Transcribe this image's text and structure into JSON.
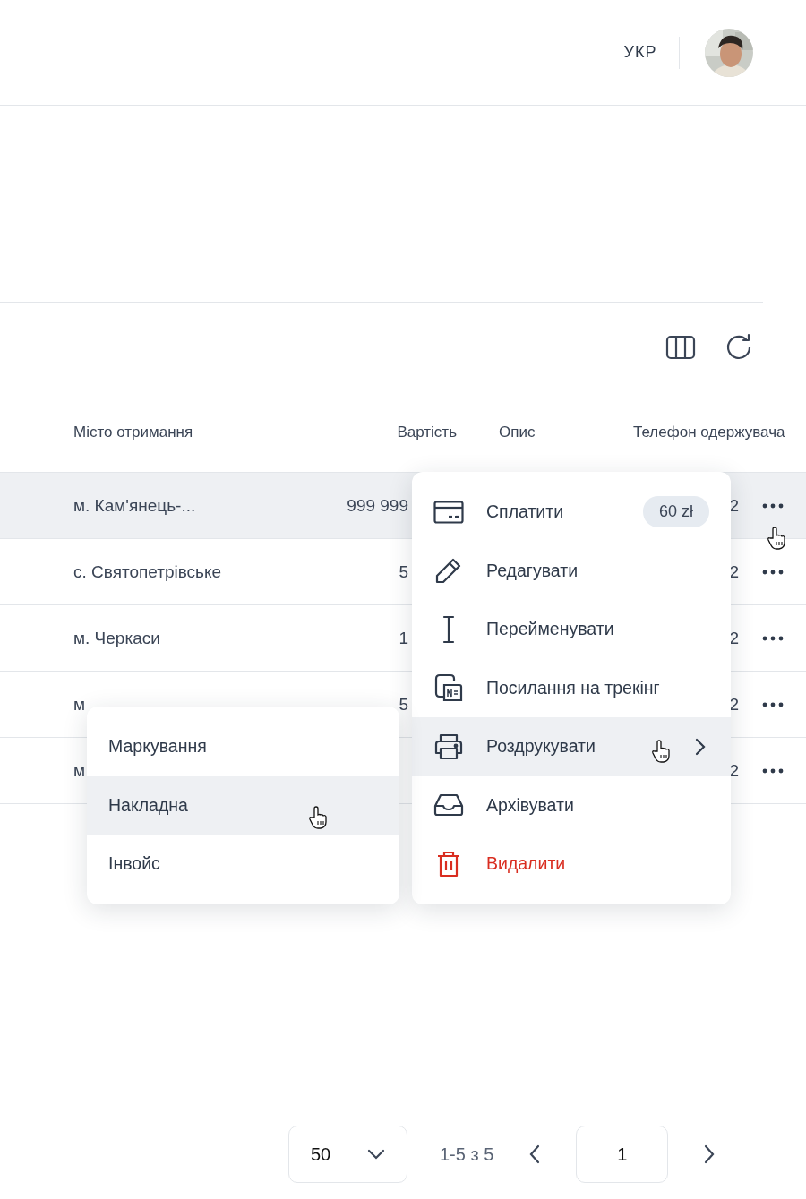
{
  "header": {
    "language": "УКР"
  },
  "table": {
    "columns": [
      "Місто отримання",
      "Вартість",
      "Опис",
      "Телефон одержувача"
    ],
    "rows": [
      {
        "city": "м. Кам'янець-...",
        "cost": "999 999",
        "phone": "2",
        "highlighted": true
      },
      {
        "city": "с. Святопетрівське",
        "cost": "5",
        "phone": "2",
        "highlighted": false
      },
      {
        "city": "м. Черкаси",
        "cost": "1",
        "phone": "2",
        "highlighted": false
      },
      {
        "city": "м",
        "cost": "5",
        "phone": "2",
        "highlighted": false
      },
      {
        "city": "м",
        "phone": "2",
        "highlighted": false
      }
    ]
  },
  "actions_menu": {
    "items": [
      {
        "label": "Сплатити",
        "badge": "60 zł",
        "kind": "normal",
        "highlighted": false,
        "submenu": false
      },
      {
        "label": "Редагувати",
        "kind": "normal",
        "highlighted": false,
        "submenu": false
      },
      {
        "label": "Перейменувати",
        "kind": "normal",
        "highlighted": false,
        "submenu": false
      },
      {
        "label": "Посилання на трекінг",
        "kind": "normal",
        "highlighted": false,
        "submenu": false
      },
      {
        "label": "Роздрукувати",
        "kind": "normal",
        "highlighted": true,
        "submenu": true
      },
      {
        "label": "Архівувати",
        "kind": "normal",
        "highlighted": false,
        "submenu": false
      },
      {
        "label": "Видалити",
        "kind": "danger",
        "highlighted": false,
        "submenu": false
      }
    ]
  },
  "print_submenu": {
    "items": [
      {
        "label": "Маркування",
        "highlighted": false
      },
      {
        "label": "Накладна",
        "highlighted": true
      },
      {
        "label": "Інвойс",
        "highlighted": false
      }
    ]
  },
  "pagination": {
    "page_size": "50",
    "range": "1-5 з 5",
    "page": "1"
  }
}
